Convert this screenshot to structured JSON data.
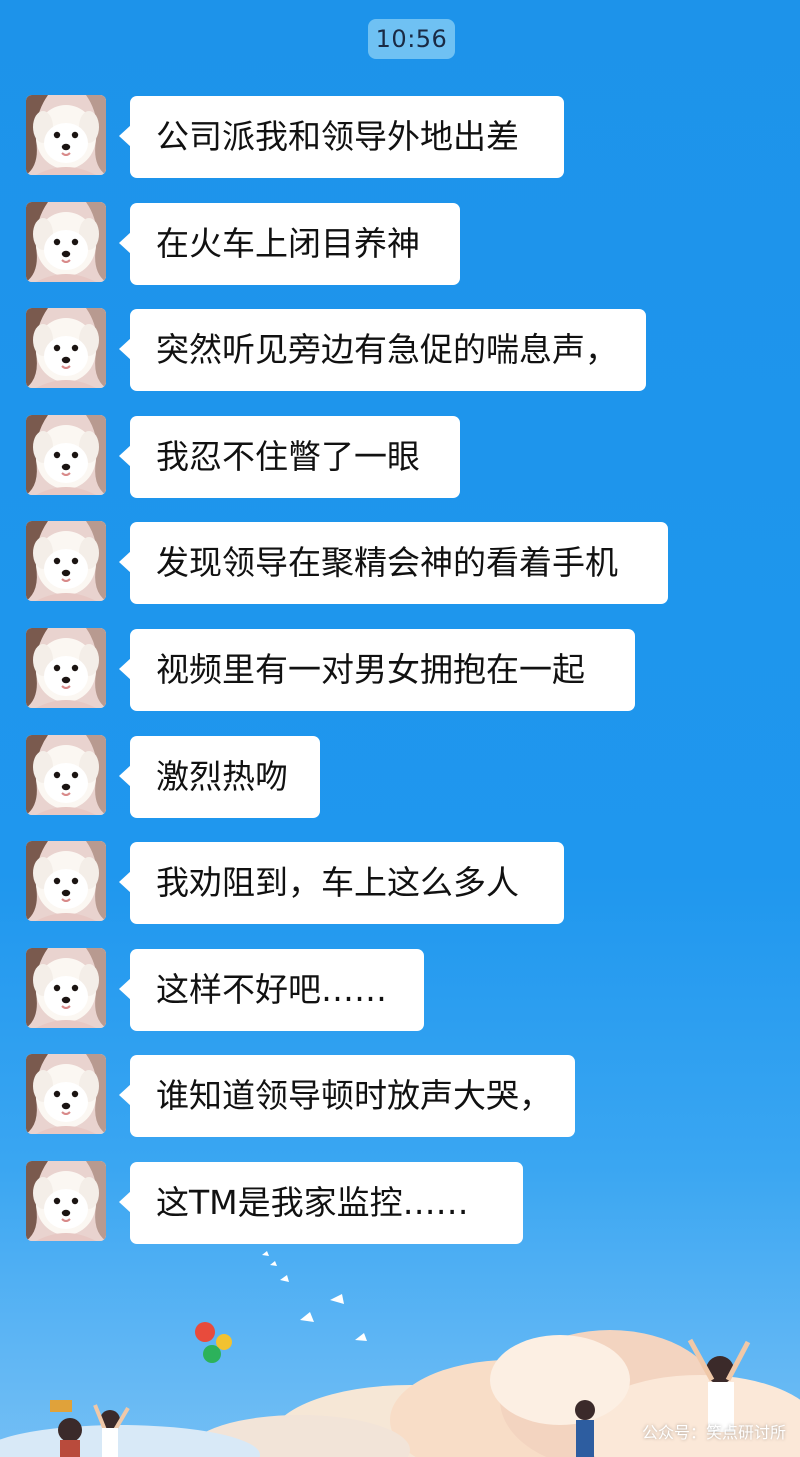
{
  "chat": {
    "timestamp": "10:56",
    "messages": [
      {
        "text": "公司派我和领导外地出差"
      },
      {
        "text": "在火车上闭目养神"
      },
      {
        "text": "突然听见旁边有急促的喘息声，"
      },
      {
        "text": "我忍不住瞥了一眼"
      },
      {
        "text": "发现领导在聚精会神的看着手机"
      },
      {
        "text": "视频里有一对男女拥抱在一起"
      },
      {
        "text": "激烈热吻"
      },
      {
        "text": "我劝阻到，车上这么多人"
      },
      {
        "text": "这样不好吧……"
      },
      {
        "text": "谁知道领导顿时放声大哭，"
      },
      {
        "text": "这TM是我家监控……"
      }
    ]
  },
  "watermark": "公众号：笑点研讨所",
  "colors": {
    "chat_background": "#1e96ec",
    "bubble": "#ffffff",
    "time_badge": "#6fc1f3"
  },
  "icons": {
    "avatar": "white-puppy-avatar"
  }
}
